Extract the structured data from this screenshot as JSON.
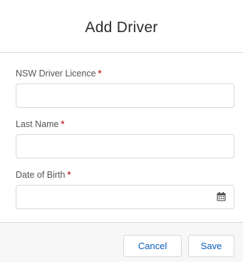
{
  "modal": {
    "title": "Add Driver"
  },
  "fields": {
    "licence": {
      "label": "NSW Driver Licence",
      "required_marker": "*",
      "value": "",
      "placeholder": ""
    },
    "last_name": {
      "label": "Last Name",
      "required_marker": "*",
      "value": "",
      "placeholder": ""
    },
    "dob": {
      "label": "Date of Birth",
      "required_marker": "*",
      "value": "",
      "placeholder": "",
      "icon": "calendar-icon"
    }
  },
  "footer": {
    "cancel_label": "Cancel",
    "save_label": "Save"
  },
  "colors": {
    "required": "#c23934",
    "button_text": "#0a5db8",
    "border": "#d8d8d8",
    "calendar_icon": "#4a4a4a"
  }
}
